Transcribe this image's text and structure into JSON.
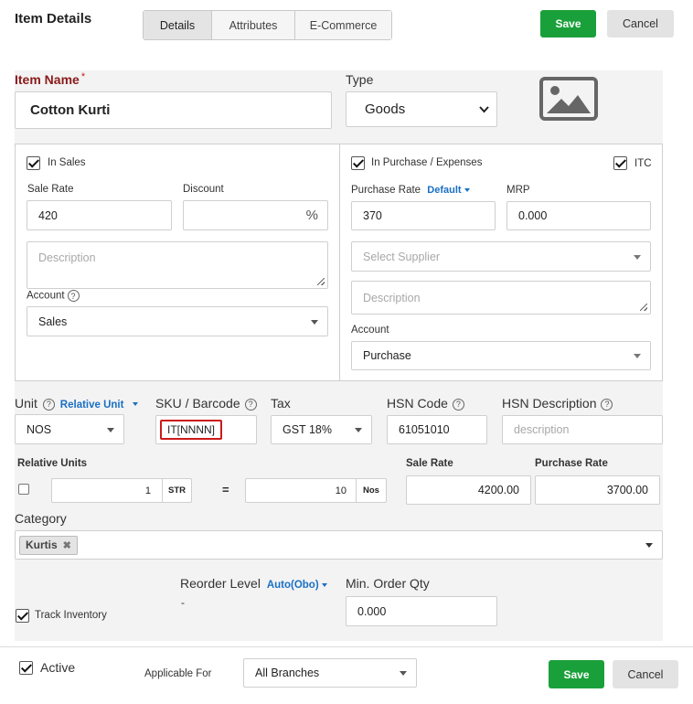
{
  "header": {
    "title": "Item Details",
    "tabs": [
      {
        "label": "Details"
      },
      {
        "label": "Attributes"
      },
      {
        "label": "E-Commerce"
      }
    ],
    "save_label": "Save",
    "cancel_label": "Cancel"
  },
  "item": {
    "name_label": "Item Name",
    "required_mark": "*",
    "name_value": "Cotton Kurti",
    "type_label": "Type",
    "type_value": "Goods",
    "image_icon": "image-placeholder-icon"
  },
  "sales": {
    "checkbox_label": "In Sales",
    "checked": true,
    "sale_rate_label": "Sale Rate",
    "sale_rate_value": "420",
    "discount_label": "Discount",
    "discount_value": "",
    "discount_suffix": "%",
    "description_placeholder": "Description",
    "account_label": "Account",
    "account_value": "Sales"
  },
  "purchase": {
    "checkbox_label": "In Purchase / Expenses",
    "checked": true,
    "itc_label": "ITC",
    "itc_checked": true,
    "purchase_rate_label": "Purchase Rate",
    "default_link": "Default",
    "purchase_rate_value": "370",
    "mrp_label": "MRP",
    "mrp_value": "0.000",
    "supplier_placeholder": "Select Supplier",
    "description_placeholder": "Description",
    "account_label": "Account",
    "account_value": "Purchase"
  },
  "unit_row": {
    "unit_label": "Unit",
    "relative_unit_link": "Relative Unit",
    "unit_value": "NOS",
    "sku_label": "SKU / Barcode",
    "sku_value": "IT[NNNN]",
    "tax_label": "Tax",
    "tax_value": "GST 18%",
    "hsn_label": "HSN Code",
    "hsn_value": "61051010",
    "hsn_desc_label": "HSN Description",
    "hsn_desc_placeholder": "description"
  },
  "relative_units": {
    "label": "Relative Units",
    "checked": false,
    "qty_left": "1",
    "unit_left": "STR",
    "equals": "=",
    "qty_right": "10",
    "unit_right": "Nos",
    "sale_rate_label": "Sale Rate",
    "sale_rate_value": "4200.00",
    "purchase_rate_label": "Purchase Rate",
    "purchase_rate_value": "3700.00"
  },
  "category": {
    "label": "Category",
    "chips": [
      {
        "label": "Kurtis",
        "remove": "✖"
      }
    ]
  },
  "inventory": {
    "track_label": "Track Inventory",
    "track_checked": true,
    "reorder_label": "Reorder Level",
    "reorder_link": "Auto(Obo)",
    "reorder_value": "-",
    "min_order_label": "Min. Order Qty",
    "min_order_value": "0.000"
  },
  "footer": {
    "active_label": "Active",
    "active_checked": true,
    "applicable_label": "Applicable For",
    "applicable_value": "All Branches",
    "save_label": "Save",
    "cancel_label": "Cancel"
  },
  "colors": {
    "save_green": "#1aa03a",
    "required_red": "#8b1a1a",
    "link_blue": "#1a6fc4",
    "sku_highlight": "#cc1a1a"
  }
}
